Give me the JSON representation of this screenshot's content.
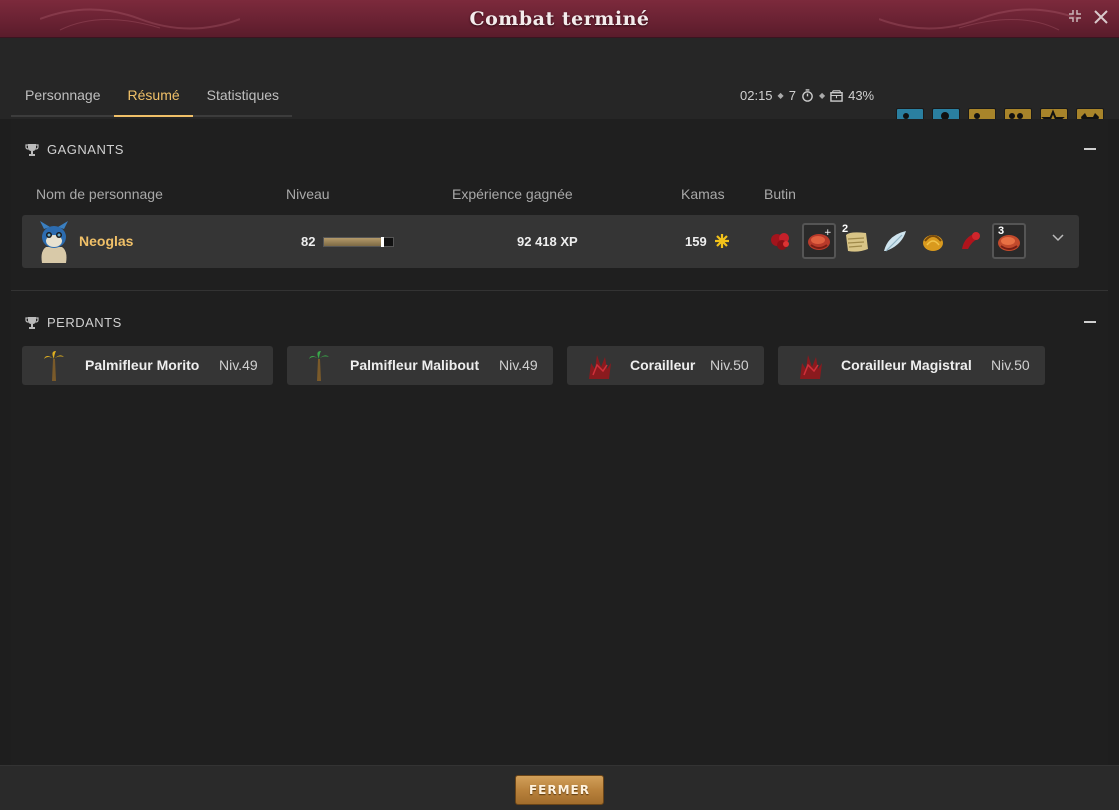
{
  "window": {
    "title": "Combat terminé",
    "minimize_icon": "shrink-icon",
    "close_icon": "close-icon"
  },
  "tabs": [
    {
      "label": "Personnage",
      "active": false
    },
    {
      "label": "Résumé",
      "active": true
    },
    {
      "label": "Statistiques",
      "active": false
    }
  ],
  "fight_info": {
    "duration": "02:15",
    "turns": "7",
    "bonus": "43%"
  },
  "challenges": [
    {
      "icon": "challenge-icon",
      "status": "success",
      "color": "#2a7fa0"
    },
    {
      "icon": "challenge-icon",
      "status": "success",
      "color": "#2a7fa0"
    },
    {
      "icon": "challenge-icon",
      "status": "success",
      "color": "#a8842a"
    },
    {
      "icon": "challenge-icon",
      "status": "success",
      "color": "#a8842a"
    },
    {
      "icon": "challenge-icon",
      "status": "failed",
      "color": "#a8842a"
    },
    {
      "icon": "challenge-icon",
      "status": "failed",
      "color": "#a8842a"
    }
  ],
  "winners": {
    "title": "GAGNANTS",
    "columns": {
      "name": "Nom de personnage",
      "level": "Niveau",
      "xp": "Expérience gagnée",
      "kamas": "Kamas",
      "loot": "Butin"
    },
    "rows": [
      {
        "name": "Neoglas",
        "level": "82",
        "level_progress": 0.85,
        "xp": "92 418 XP",
        "kamas": "159",
        "loot": [
          {
            "icon": "red-bundle-icon",
            "qty": "",
            "boxed": false
          },
          {
            "icon": "meat-icon",
            "qty": "",
            "boxed": true
          },
          {
            "icon": "parchment-icon",
            "qty": "2",
            "boxed": false
          },
          {
            "icon": "feather-icon",
            "qty": "",
            "boxed": false
          },
          {
            "icon": "shell-icon",
            "qty": "",
            "boxed": false
          },
          {
            "icon": "red-claw-icon",
            "qty": "",
            "boxed": false
          },
          {
            "icon": "meat-icon",
            "qty": "3",
            "boxed": true
          }
        ]
      }
    ]
  },
  "losers": {
    "title": "PERDANTS",
    "rows": [
      {
        "name": "Palmifleur Morito",
        "level": "Niv.49"
      },
      {
        "name": "Palmifleur Malibout",
        "level": "Niv.49"
      },
      {
        "name": "Corailleur",
        "level": "Niv.50"
      },
      {
        "name": "Corailleur Magistral",
        "level": "Niv.50"
      }
    ]
  },
  "footer": {
    "close_label": "FERMER"
  }
}
